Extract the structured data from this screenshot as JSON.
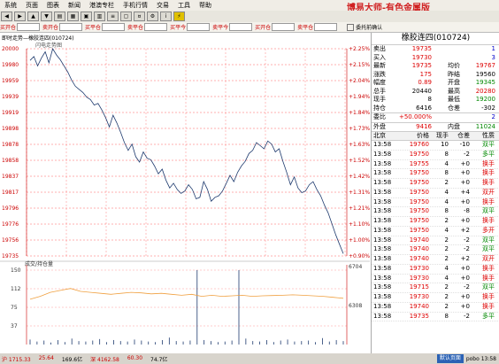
{
  "menu": [
    "系统",
    "页面",
    "图表",
    "新闻",
    "港澳专栏",
    "手机行情",
    "交易",
    "工具",
    "帮助"
  ],
  "app_title": "博易大师-有色金属版",
  "order_bar": {
    "labels": [
      "买开仓",
      "卖开仓",
      "买平仓",
      "卖平仓",
      "买平今",
      "卖平今",
      "买开仓",
      "卖平仓"
    ],
    "confirm_label": "委托前确认"
  },
  "chart": {
    "title": "即时走势—橡胶连四(010724)",
    "subtitle": "闪电走势图",
    "price_ticks": [
      "20000",
      "19980",
      "19959",
      "19939",
      "19919",
      "19898",
      "19878",
      "19858",
      "19837",
      "19817",
      "19796",
      "19776",
      "19756",
      "19735"
    ],
    "pct_ticks": [
      "+2.25%",
      "+2.15%",
      "+2.04%",
      "+1.94%",
      "+1.84%",
      "+1.73%",
      "+1.63%",
      "+1.52%",
      "+1.42%",
      "+1.31%",
      "+1.21%",
      "+1.10%",
      "+1.00%",
      "+0.90%"
    ],
    "vol_label": "成交/持仓量",
    "vol_ticks": [
      "150",
      "112",
      "75",
      "37"
    ],
    "oi_ticks": [
      "6704",
      "6308"
    ],
    "series_points": [
      19985,
      19990,
      19978,
      19988,
      19996,
      19982,
      20000,
      19992,
      19986,
      19978,
      19970,
      19960,
      19952,
      19948,
      19944,
      19938,
      19935,
      19928,
      19930,
      19922,
      19912,
      19900,
      19915,
      19905,
      19893,
      19880,
      19870,
      19878,
      19862,
      19855,
      19868,
      19860,
      19858,
      19850,
      19840,
      19846,
      19832,
      19822,
      19828,
      19820,
      19815,
      19818,
      19826,
      19820,
      19808,
      19810,
      19830,
      19820,
      19805,
      19810,
      19812,
      19818,
      19828,
      19838,
      19830,
      19842,
      19850,
      19856,
      19866,
      19870,
      19880,
      19876,
      19872,
      19882,
      19878,
      19868,
      19872,
      19856,
      19842,
      19826,
      19836,
      19822,
      19816,
      19818,
      19826,
      19830,
      19820,
      19812,
      19800,
      19790,
      19776,
      19762,
      19750,
      19738
    ],
    "oi_points": [
      6390,
      6420,
      6460,
      6480,
      6500,
      6470,
      6460,
      6450,
      6440,
      6450,
      6460,
      6455,
      6445,
      6450,
      6440,
      6430,
      6440,
      6420,
      6430,
      6420,
      6425,
      6430,
      6420,
      6425,
      6428,
      6430,
      6435,
      6430,
      6425,
      6420,
      6410,
      6400
    ],
    "vol_bars": [
      10,
      6,
      8,
      4,
      9,
      5,
      12,
      7,
      6,
      8,
      11,
      5,
      9,
      7,
      6,
      10,
      8,
      6,
      5,
      9,
      14,
      7,
      6,
      8,
      150,
      9,
      7,
      5,
      6,
      8,
      150,
      12,
      7,
      6,
      9,
      5,
      8,
      10,
      6,
      7,
      8,
      5,
      13,
      6,
      9,
      7
    ]
  },
  "quote": {
    "instrument": "橡胶连四(010724)",
    "rows": [
      {
        "l": "卖出",
        "v": "19735",
        "v_color": "red",
        "r": "",
        "rv": "1",
        "rv_color": "blu"
      },
      {
        "l": "买入",
        "v": "19730",
        "v_color": "red",
        "r": "",
        "rv": "3",
        "rv_color": "blu"
      },
      {
        "l": "最新",
        "v": "19735",
        "v_color": "red",
        "r": "均价",
        "rv": "19767",
        "rv_color": "red"
      },
      {
        "l": "涨跌",
        "v": "175",
        "v_color": "red",
        "r": "昨结",
        "rv": "19560",
        "rv_color": ""
      },
      {
        "l": "幅度",
        "v": "0.89",
        "v_color": "red",
        "r": "开盘",
        "rv": "19345",
        "rv_color": "grn"
      },
      {
        "l": "总手",
        "v": "20440",
        "v_color": "",
        "r": "最高",
        "rv": "20280",
        "rv_color": "red"
      },
      {
        "l": "现手",
        "v": "8",
        "v_color": "",
        "r": "最低",
        "rv": "19200",
        "rv_color": "grn"
      },
      {
        "l": "持仓",
        "v": "6416",
        "v_color": "",
        "r": "仓差",
        "rv": "-302",
        "rv_color": ""
      }
    ],
    "commit": {
      "label": "委比",
      "value": "+50.000%",
      "right": "2"
    },
    "outer": {
      "label": "外盘",
      "value": "9416",
      "right_label": "内盘",
      "right_value": "11024"
    }
  },
  "ticks": {
    "headers": [
      "北京",
      "价格",
      "现手",
      "仓差",
      "性质"
    ],
    "rows": [
      {
        "t": "13:58",
        "p": "19760",
        "q": "10",
        "d": "-10",
        "n": "双平",
        "nc": "grn"
      },
      {
        "t": "13:58",
        "p": "19750",
        "q": "8",
        "d": "-2",
        "n": "多平",
        "nc": "grn"
      },
      {
        "t": "13:58",
        "p": "19755",
        "q": "4",
        "d": "+0",
        "n": "换手",
        "nc": "red"
      },
      {
        "t": "13:58",
        "p": "19750",
        "q": "8",
        "d": "+0",
        "n": "换手",
        "nc": "red"
      },
      {
        "t": "13:58",
        "p": "19750",
        "q": "2",
        "d": "+0",
        "n": "换手",
        "nc": "red"
      },
      {
        "t": "13:58",
        "p": "19750",
        "q": "4",
        "d": "+4",
        "n": "双开",
        "nc": "red"
      },
      {
        "t": "13:58",
        "p": "19750",
        "q": "4",
        "d": "+0",
        "n": "换手",
        "nc": "red"
      },
      {
        "t": "13:58",
        "p": "19750",
        "q": "8",
        "d": "-8",
        "n": "双平",
        "nc": "grn"
      },
      {
        "t": "13:58",
        "p": "19750",
        "q": "2",
        "d": "+0",
        "n": "换手",
        "nc": "red"
      },
      {
        "t": "13:58",
        "p": "19750",
        "q": "4",
        "d": "+2",
        "n": "多开",
        "nc": "red"
      },
      {
        "t": "13:58",
        "p": "19740",
        "q": "2",
        "d": "-2",
        "n": "双平",
        "nc": "grn"
      },
      {
        "t": "13:58",
        "p": "19740",
        "q": "2",
        "d": "-2",
        "n": "双平",
        "nc": "grn"
      },
      {
        "t": "13:58",
        "p": "19740",
        "q": "2",
        "d": "+2",
        "n": "双开",
        "nc": "red"
      },
      {
        "t": "13:58",
        "p": "19730",
        "q": "4",
        "d": "+0",
        "n": "换手",
        "nc": "red"
      },
      {
        "t": "13:58",
        "p": "19730",
        "q": "4",
        "d": "+0",
        "n": "换手",
        "nc": "red"
      },
      {
        "t": "13:58",
        "p": "19715",
        "q": "2",
        "d": "-2",
        "n": "双平",
        "nc": "grn"
      },
      {
        "t": "13:58",
        "p": "19730",
        "q": "2",
        "d": "+0",
        "n": "换手",
        "nc": "red"
      },
      {
        "t": "13:58",
        "p": "19740",
        "q": "2",
        "d": "+0",
        "n": "换手",
        "nc": "red"
      },
      {
        "t": "13:58",
        "p": "19735",
        "q": "8",
        "d": "-2",
        "n": "多平",
        "nc": "grn"
      }
    ]
  },
  "status": {
    "items": [
      {
        "v": "沪 1715.33",
        "c": "sb-red"
      },
      {
        "v": "25.64",
        "c": "sb-red"
      },
      {
        "v": "169.6亿",
        "c": ""
      },
      {
        "v": "深 4162.58",
        "c": "sb-red"
      },
      {
        "v": "60.30",
        "c": "sb-red"
      },
      {
        "v": "74.7亿",
        "c": ""
      }
    ],
    "button": "默认页面",
    "right": "pobo 13:58"
  },
  "colors": {
    "price_line": "#1e3a6e",
    "oi_line": "#f0a040",
    "vol_bar": "#1e3a6e",
    "grid": "#ff6060",
    "vol_grid": "#ff8080"
  }
}
